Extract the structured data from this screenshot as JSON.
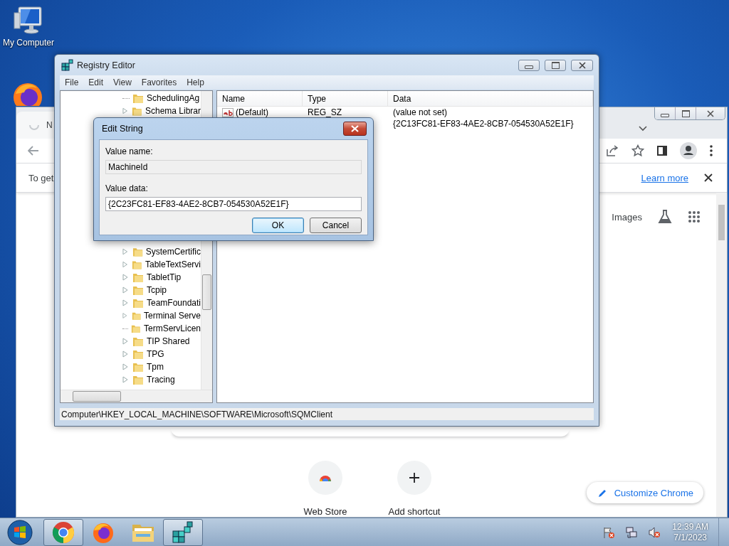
{
  "desktop": {
    "icons": [
      {
        "kind": "computer",
        "label": "My Computer"
      },
      {
        "kind": "firefox"
      }
    ]
  },
  "browser": {
    "tab": {
      "title": "N"
    },
    "infobar": {
      "text": "To get",
      "link": "Learn more"
    },
    "links": [
      "Images"
    ],
    "shortcuts": [
      {
        "kind": "store",
        "label": "Web Store"
      },
      {
        "kind": "add",
        "label": "Add shortcut"
      }
    ],
    "customize_button": "Customize Chrome"
  },
  "registry_editor": {
    "title": "Registry Editor",
    "menu": [
      "File",
      "Edit",
      "View",
      "Favorites",
      "Help"
    ],
    "tree": [
      {
        "label": "SchedulingAg",
        "expandable": false
      },
      {
        "label": "Schema Librar",
        "expandable": true
      },
      {
        "label": "SystemCertific",
        "expandable": true
      },
      {
        "label": "TableTextServi",
        "expandable": true
      },
      {
        "label": "TabletTip",
        "expandable": true
      },
      {
        "label": "Tcpip",
        "expandable": true
      },
      {
        "label": "TeamFoundati",
        "expandable": true
      },
      {
        "label": "Terminal Serve",
        "expandable": true
      },
      {
        "label": "TermServLicen",
        "expandable": false
      },
      {
        "label": "TIP Shared",
        "expandable": true
      },
      {
        "label": "TPG",
        "expandable": true
      },
      {
        "label": "Tpm",
        "expandable": true
      },
      {
        "label": "Tracing",
        "expandable": true
      }
    ],
    "columns": [
      "Name",
      "Type",
      "Data"
    ],
    "values": [
      {
        "name": "(Default)",
        "type": "REG_SZ",
        "data": "(value not set)"
      },
      {
        "data": "{2C13FC81-EF83-4AE2-8CB7-054530A52E1F}"
      }
    ],
    "status_path": "Computer\\HKEY_LOCAL_MACHINE\\SOFTWARE\\Microsoft\\SQMClient"
  },
  "dialog": {
    "title": "Edit String",
    "value_name_label": "Value name:",
    "value_name": "MachineId",
    "value_data_label": "Value data:",
    "value_data": "{2C23FC81-EF83-4AE2-8CB7-054530A52E1F}",
    "buttons": [
      {
        "label": "OK",
        "selected": true
      },
      {
        "label": "Cancel",
        "selected": false
      }
    ]
  },
  "taskbar": {
    "apps": [
      {
        "kind": "chrome",
        "running": true
      },
      {
        "kind": "firefox",
        "running": false
      },
      {
        "kind": "explorer",
        "running": false
      },
      {
        "kind": "regedit",
        "running": true
      }
    ],
    "clock": {
      "time": "12:39 AM",
      "date": "7/1/2023"
    }
  }
}
